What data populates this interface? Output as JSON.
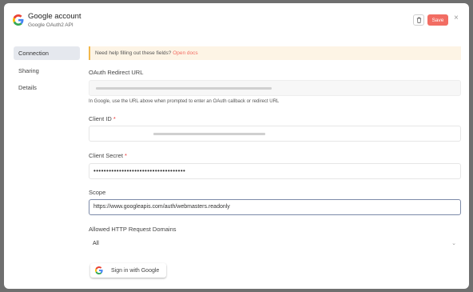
{
  "header": {
    "title": "Google account",
    "subtitle": "Google OAuth2 API",
    "save_label": "Save",
    "close_glyph": "×"
  },
  "sidebar": {
    "items": [
      {
        "label": "Connection"
      },
      {
        "label": "Sharing"
      },
      {
        "label": "Details"
      }
    ]
  },
  "notice": {
    "text": "Need help filling out these fields?",
    "link": "Open docs"
  },
  "fields": {
    "redirect": {
      "label": "OAuth Redirect URL",
      "hint": "In Google, use the URL above when prompted to enter an OAuth callback or redirect URL"
    },
    "client_id": {
      "label": "Client ID",
      "required": "*"
    },
    "client_secret": {
      "label": "Client Secret",
      "required": "*",
      "value": "••••••••••••••••••••••••••••••••••••"
    },
    "scope": {
      "label": "Scope",
      "value": "https://www.googleapis.com/auth/webmasters.readonly"
    },
    "domains": {
      "label": "Allowed HTTP Request Domains",
      "value": "All"
    }
  },
  "google_button": {
    "label": "Sign in with Google"
  },
  "colors": {
    "accent": "#f26d63",
    "active_bg": "#e5e8ee",
    "notice_bg": "#fdf4e5"
  }
}
